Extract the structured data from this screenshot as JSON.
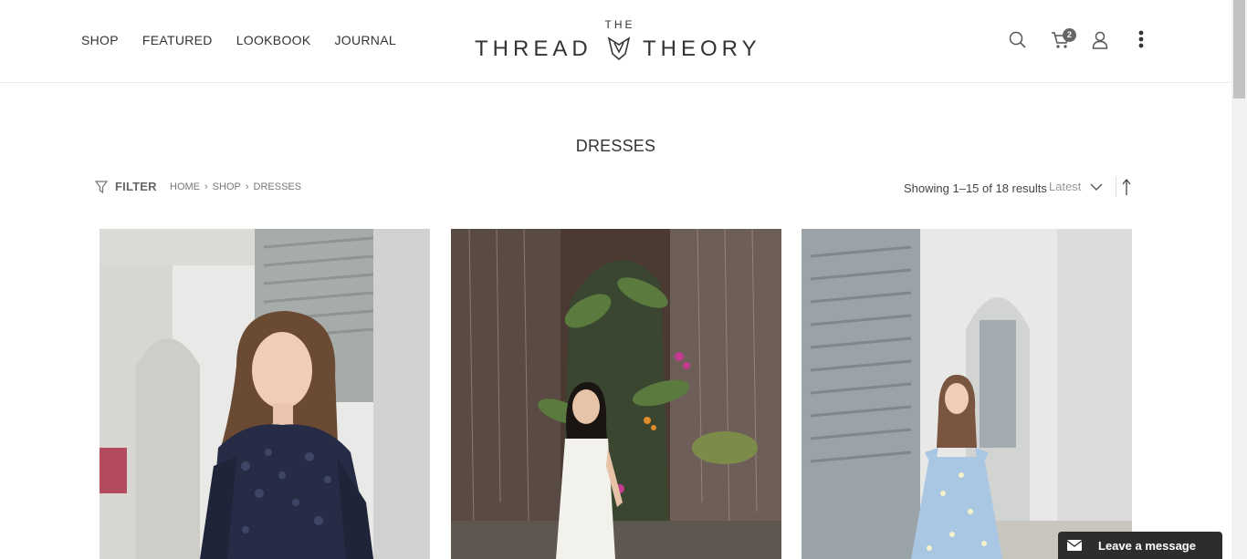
{
  "nav": {
    "items": [
      {
        "label": "SHOP"
      },
      {
        "label": "FEATURED"
      },
      {
        "label": "LOOKBOOK"
      },
      {
        "label": "JOURNAL"
      }
    ]
  },
  "brand": {
    "small": "THE",
    "left": "THREAD",
    "right": "THEORY"
  },
  "header_icons": {
    "search": "search-icon",
    "cart": "cart-icon",
    "cart_count": "2",
    "account": "user-icon",
    "menu": "more-vertical-icon"
  },
  "page": {
    "title": "DRESSES"
  },
  "toolbar": {
    "filter_label": "FILTER",
    "breadcrumb": [
      "HOME",
      "SHOP",
      "DRESSES"
    ],
    "results_text": "Showing 1–15 of 18 results",
    "sort_selected": "Latest"
  },
  "chat": {
    "label": "Leave a message"
  },
  "colors": {
    "text": "#333333",
    "chat_bg": "#2d2d2d",
    "badge": "#666666"
  }
}
